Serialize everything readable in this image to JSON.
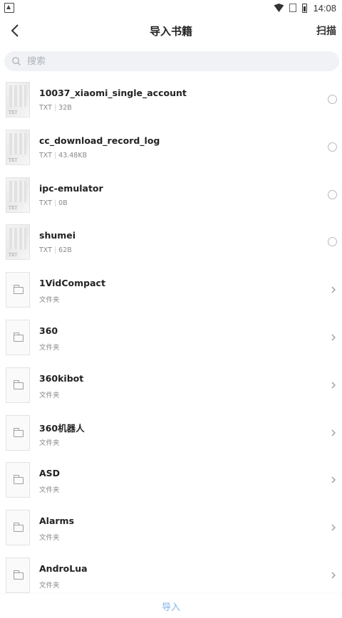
{
  "status_bar": {
    "time": "14:08"
  },
  "app_bar": {
    "title": "导入书籍",
    "scan_label": "扫描"
  },
  "search": {
    "placeholder": "搜索",
    "value": ""
  },
  "files": [
    {
      "name": "10037_xiaomi_single_account",
      "type": "TXT",
      "size": "32B",
      "thumb_tag": "TXT"
    },
    {
      "name": "cc_download_record_log",
      "type": "TXT",
      "size": "43.48KB",
      "thumb_tag": "TXT"
    },
    {
      "name": "ipc-emulator",
      "type": "TXT",
      "size": "0B",
      "thumb_tag": "TXT"
    },
    {
      "name": "shumei",
      "type": "TXT",
      "size": "62B",
      "thumb_tag": "TXT"
    }
  ],
  "folders": [
    {
      "name": "1VidCompact",
      "meta": "文件夹"
    },
    {
      "name": "360",
      "meta": "文件夹"
    },
    {
      "name": "360kibot",
      "meta": "文件夹"
    },
    {
      "name": "360机器人",
      "meta": "文件夹"
    },
    {
      "name": "ASD",
      "meta": "文件夹"
    },
    {
      "name": "Alarms",
      "meta": "文件夹"
    },
    {
      "name": "AndroLua",
      "meta": "文件夹"
    }
  ],
  "bottom": {
    "import_label": "导入"
  },
  "colors": {
    "accent": "#7fb4e8",
    "search_bg": "#f0f2f5"
  }
}
